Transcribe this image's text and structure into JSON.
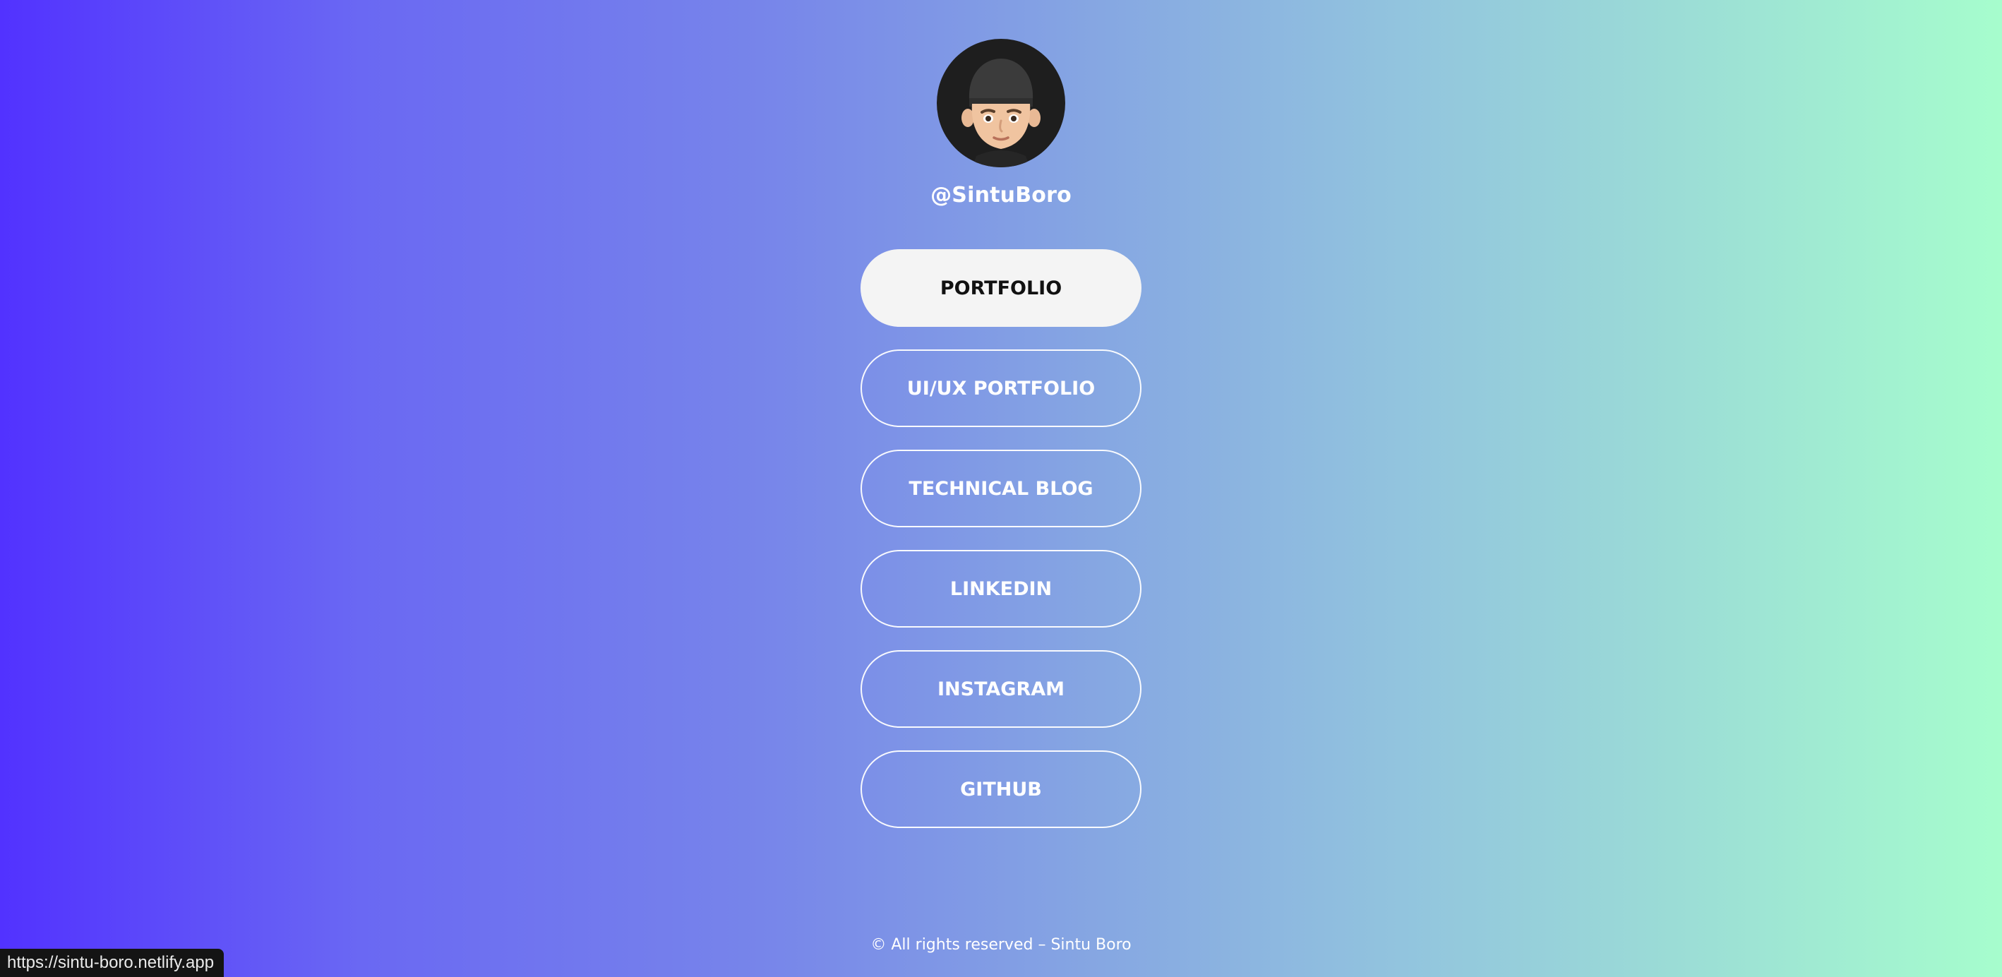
{
  "profile": {
    "avatar_alt": "memoji avatar",
    "handle": "@SintuBoro"
  },
  "links": [
    {
      "label": "PORTFOLIO",
      "active": true
    },
    {
      "label": "UI/UX PORTFOLIO",
      "active": false
    },
    {
      "label": "TECHNICAL BLOG",
      "active": false
    },
    {
      "label": "LINKEDIN",
      "active": false
    },
    {
      "label": "INSTAGRAM",
      "active": false
    },
    {
      "label": "GITHUB",
      "active": false
    }
  ],
  "footer": {
    "text": "© All rights reserved – Sintu Boro"
  },
  "status_bar": {
    "url": "https://sintu-boro.netlify.app"
  },
  "colors": {
    "gradient_left": "#5232ff",
    "gradient_right": "#a6fdcd",
    "active_button_bg": "#f4f4f4",
    "text": "#ffffff"
  }
}
